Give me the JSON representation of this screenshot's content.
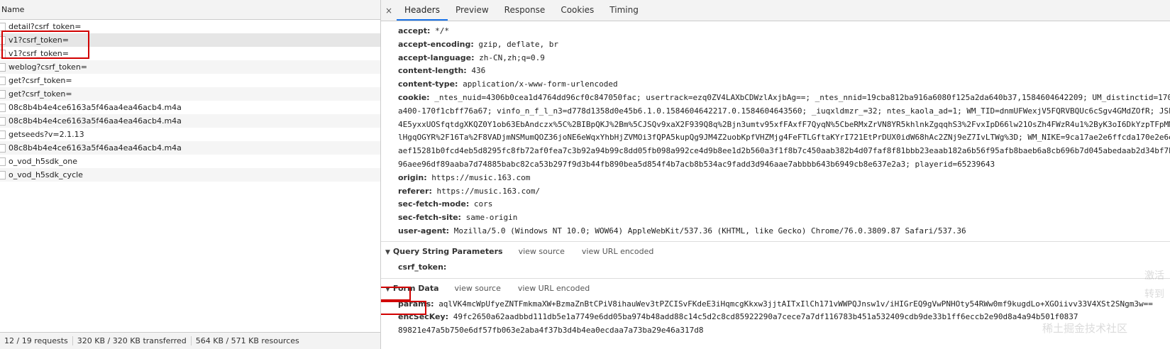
{
  "left_panel": {
    "name_header": "Name",
    "requests": [
      {
        "name": "detail?csrf_token="
      },
      {
        "name": "v1?csrf_token="
      },
      {
        "name": "v1?csrf_token="
      },
      {
        "name": "weblog?csrf_token="
      },
      {
        "name": "get?csrf_token="
      },
      {
        "name": "get?csrf_token="
      },
      {
        "name": "08c8b4b4e4ce6163a5f46aa4ea46acb4.m4a"
      },
      {
        "name": "08c8b4b4e4ce6163a5f46aa4ea46acb4.m4a"
      },
      {
        "name": "getseeds?v=2.1.13"
      },
      {
        "name": "08c8b4b4e4ce6163a5f46aa4ea46acb4.m4a"
      },
      {
        "name": "o_vod_h5sdk_one"
      },
      {
        "name": "o_vod_h5sdk_cycle"
      }
    ],
    "status": {
      "requests": "12 / 19 requests",
      "transferred": "320 KB / 320 KB transferred",
      "resources": "564 KB / 571 KB resources"
    }
  },
  "tabs": {
    "close": "×",
    "items": [
      "Headers",
      "Preview",
      "Response",
      "Cookies",
      "Timing"
    ],
    "active": "Headers"
  },
  "request_headers": [
    {
      "key": "accept:",
      "value": "*/*"
    },
    {
      "key": "accept-encoding:",
      "value": "gzip, deflate, br"
    },
    {
      "key": "accept-language:",
      "value": "zh-CN,zh;q=0.9"
    },
    {
      "key": "content-length:",
      "value": "436"
    },
    {
      "key": "content-type:",
      "value": "application/x-www-form-urlencoded"
    },
    {
      "key": "cookie:",
      "value": "_ntes_nuid=4306b0cea1d4764dd96cf0c847050fac; usertrack=ezq0ZV4LAXbCDWzlAxjbAg==; _ntes_nnid=19cba812ba916a6080f125a2da640b37,1584604642209; UM_distinctid=170f"
    }
  ],
  "cookie_continuation": [
    "a400-170f1cbff76a67; vinfo_n_f_l_n3=d778d1358d0e45b6.1.0.1584604642217.0.1584604643560; _iuqxldmzr_=32; ntes_kaola_ad=1; WM_TID=dnmUFWexjV5FQRVBQUc6cSgv4GMdZOfR; JSE",
    "4E5yxxUOSfqtdgXKQZ0Y1ob63EbAndczx%5C%2BIBpQKJ%2Bm%5CJSQv9xaX2F939Q8q%2Bjn3umtv95xfFAxfF7QyqN%5CbeRMxZrVN8YR5khlnkZgqqhS3%2FvxIpD66lw21OsZh4FWzR4u1%2ByK3oI6DkYzpTFpMMZ",
    "lHgqOGYR%2F16Ta%2F8VADjmNSMumQOZ36joNE6eWqxYhbHjZVMOi3fQPA5kupQg9JM4Z2uobKpfVHZMjg4FeFTLGftaKYrI721EtPrDUX0idW68hAc2ZNj9eZ7IvLTWg%3D; WM_NIKE=9ca17ae2e6ffcda170e2e6e",
    "aef15281b0fcd4eb5d8295fc8fb72af0fea7c3b92a94b99c8dd05fb098a992ce4d9b8ee1d2b560a3f1f8b7c450aab382b4d07faf8f81bbb23eaab182a6b56f95afb8baeb6a8cb696b7d045abedaab2d34bf7b",
    "96aee96df89aaba7d74885babc82ca53b297f9d3b44fb890bea5d854f4b7acb8b534ac9fadd3d946aae7abbbb643b6949cb8e637e2a3; playerid=65239643"
  ],
  "request_headers_2": [
    {
      "key": "origin:",
      "value": "https://music.163.com"
    },
    {
      "key": "referer:",
      "value": "https://music.163.com/"
    },
    {
      "key": "sec-fetch-mode:",
      "value": "cors"
    },
    {
      "key": "sec-fetch-site:",
      "value": "same-origin"
    },
    {
      "key": "user-agent:",
      "value": "Mozilla/5.0 (Windows NT 10.0; WOW64) AppleWebKit/537.36 (KHTML, like Gecko) Chrome/76.0.3809.87 Safari/537.36"
    }
  ],
  "query_string": {
    "title": "Query String Parameters",
    "view_source": "view source",
    "view_url_encoded": "view URL encoded",
    "params": [
      {
        "key": "csrf_token:",
        "value": ""
      }
    ]
  },
  "form_data": {
    "title": "Form Data",
    "view_source": "view source",
    "view_url_encoded": "view URL encoded",
    "params_key": "params:",
    "params_value": "aqlVK4mcWpUfyeZNTFmkmaXW+BzmaZnBtCPiV8ihauWev3tPZCISvFKdeE3iHqmcgKkxw3jjtAITxIlCh171vWWPQJnsw1v/iHIGrEQ9gVwPNHOty54RWw0mf9kugdLo+XGOiivv33V4XSt2SNgm3w==",
    "enc_key": "encSecKey:",
    "enc_value": "49fc2650a62aadbbd111db5e1a7749e6dd05ba974b48add88c14c5d2c8cd85922290a7cece7a7df116783b451a532409cdb9de33b1ff6eccb2e90d8a4a94b501f0837"
  },
  "enc_continuation": "89821e47a5b750e6df57fb063e2aba4f37b3d4b4ea0ecdaa7a73ba29e46a317d8",
  "watermark": {
    "line1": "激活",
    "line2": "转到",
    "line3": "稀土掘金技术社区"
  }
}
